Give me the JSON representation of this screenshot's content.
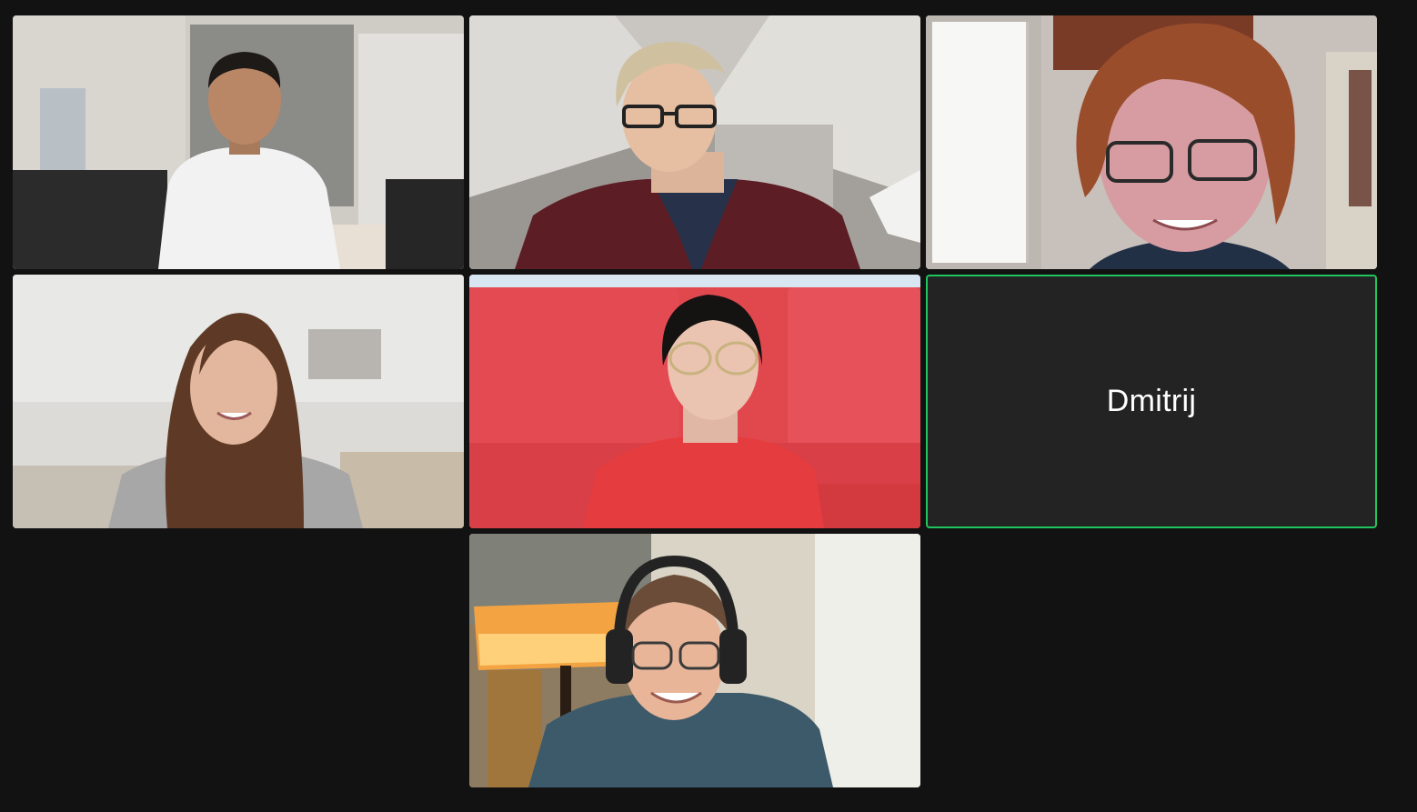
{
  "meeting": {
    "participants": [
      {
        "type": "video"
      },
      {
        "type": "video"
      },
      {
        "type": "video"
      },
      {
        "type": "video"
      },
      {
        "type": "video"
      },
      {
        "type": "avatar",
        "name": "Dmitrij",
        "active_speaker": true
      },
      {
        "type": "video"
      }
    ]
  },
  "colors": {
    "background": "#121212",
    "name_tile": "#232323",
    "active_speaker_border": "#21c55d",
    "name_text": "#ffffff"
  }
}
